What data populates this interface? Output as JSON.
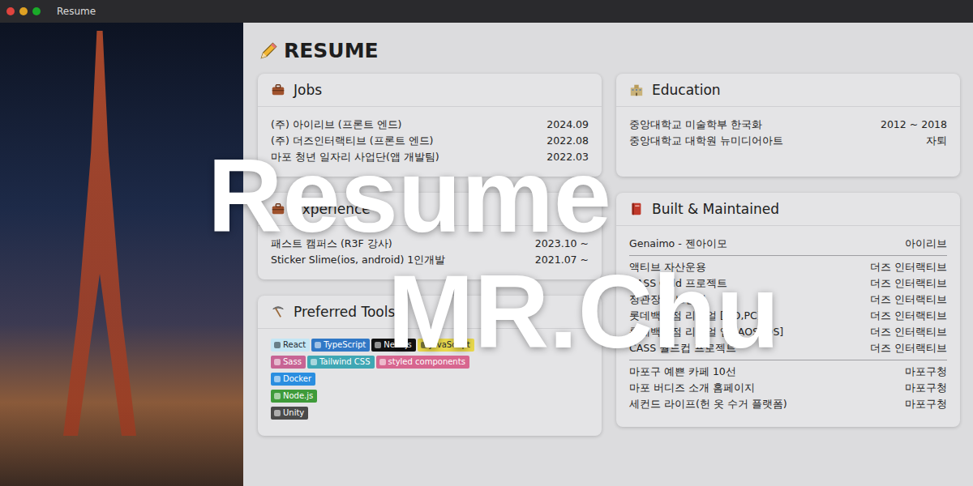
{
  "window": {
    "title": "Resume"
  },
  "heading": "RESUME",
  "overlay": {
    "lines": [
      "Resume",
      "MR.Chu"
    ]
  },
  "jobs": {
    "title": "Jobs",
    "rows": [
      {
        "name": "(주) 아이리브 (프론트 엔드)",
        "date": "2024.09"
      },
      {
        "name": "(주) 더즈인터랙티브 (프론트 엔드)",
        "date": "2022.08"
      },
      {
        "name": "마포 청년 일자리 사업단(앱 개발팀)",
        "date": "2022.03"
      }
    ]
  },
  "experience": {
    "title": "Experience",
    "rows": [
      {
        "name": "패스트 캠퍼스 (R3F 강사)",
        "date": "2023.10 ~"
      },
      {
        "name": "Sticker Slime(ios, android) 1인개발",
        "date": "2021.07 ~"
      }
    ]
  },
  "tools": {
    "title": "Preferred Tools",
    "rows": [
      [
        {
          "label": "React",
          "color": "#c4e6f4"
        },
        {
          "label": "TypeScript",
          "color": "#3178c6"
        },
        {
          "label": "Next.js",
          "color": "#111111"
        },
        {
          "label": "JavaScript",
          "color": "#e8d84c"
        }
      ],
      [
        {
          "label": "Sass",
          "color": "#c76494"
        },
        {
          "label": "Tailwind CSS",
          "color": "#3fa7b4"
        },
        {
          "label": "styled components",
          "color": "#d7668f"
        }
      ],
      [
        {
          "label": "Docker",
          "color": "#2a8ee0"
        }
      ],
      [
        {
          "label": "Node.js",
          "color": "#3f9b3a"
        }
      ],
      [
        {
          "label": "Unity",
          "color": "#4a4a4a"
        }
      ]
    ]
  },
  "education": {
    "title": "Education",
    "rows": [
      {
        "name": "중앙대학교 미술학부 한국화",
        "date": "2012 ~ 2018"
      },
      {
        "name": "중앙대학교 대학원 뉴미디어아트",
        "date": "자퇴"
      }
    ]
  },
  "built": {
    "title": "Built & Maintained",
    "groups": [
      [
        {
          "name": "Genaimo - 젠아이모",
          "org": "아이리브"
        }
      ],
      [
        {
          "name": "액티브 자산운용",
          "org": "더즈 인터랙티브"
        },
        {
          "name": "CASS Cold 프로젝트",
          "org": "더즈 인터랙티브"
        },
        {
          "name": "정관장 리브랜딩",
          "org": "더즈 인터랙티브"
        },
        {
          "name": "롯데백화점 리뉴얼 [MO,PC]",
          "org": "더즈 인터랙티브"
        },
        {
          "name": "롯데백화점 리뉴얼 앱 [AOS,IOS]",
          "org": "더즈 인터랙티브"
        },
        {
          "name": "CASS 월드컵 프로젝트",
          "org": "더즈 인터랙티브"
        }
      ],
      [
        {
          "name": "마포구 예쁜 카페 10선",
          "org": "마포구청"
        },
        {
          "name": "마포 버디즈 소개 홈페이지",
          "org": "마포구청"
        },
        {
          "name": "세컨드 라이프(헌 옷 수거 플랫폼)",
          "org": "마포구청"
        }
      ]
    ]
  }
}
